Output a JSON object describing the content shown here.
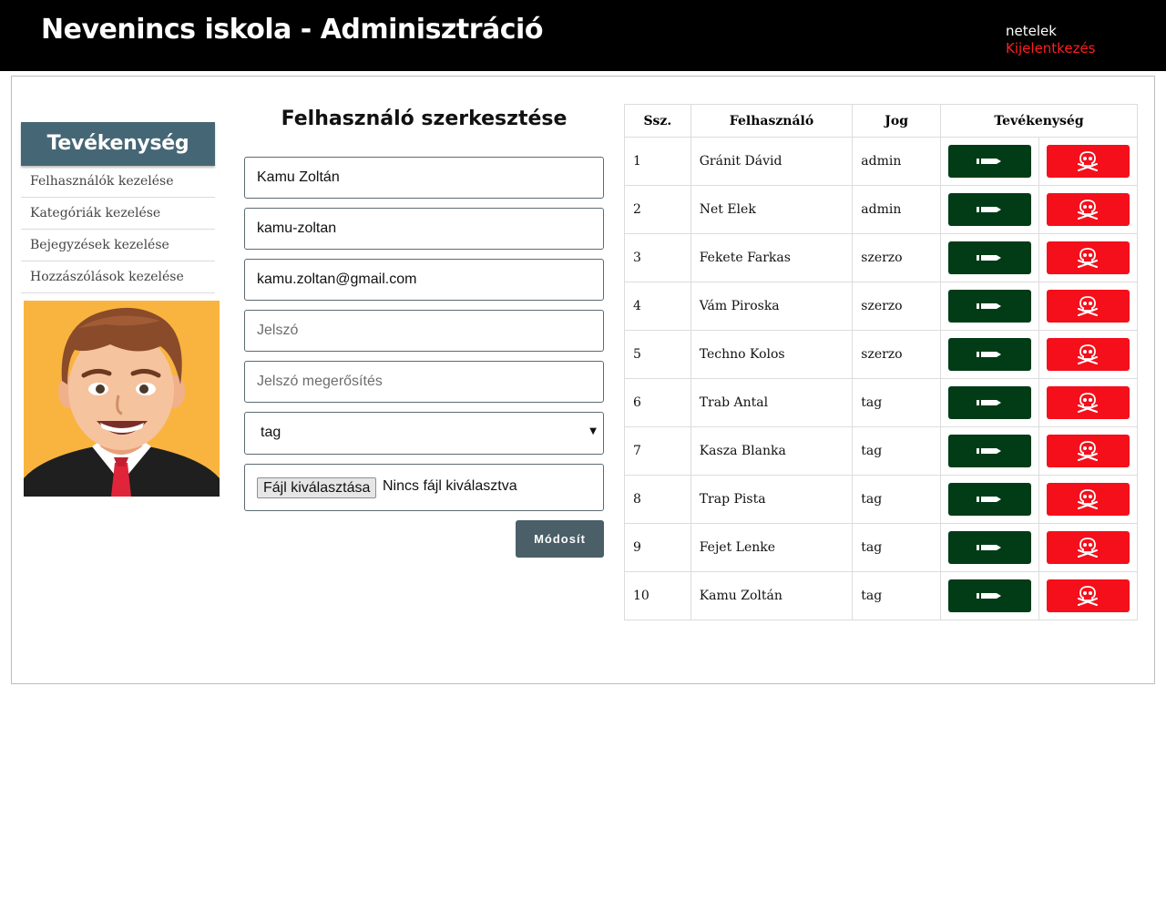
{
  "header": {
    "title": "Nevenincs iskola - Adminisztráció",
    "username": "netelek",
    "logout_label": "Kijelentkezés"
  },
  "sidebar": {
    "heading": "Tevékenység",
    "items": [
      {
        "label": "Felhasználók kezelése"
      },
      {
        "label": "Kategóriák kezelése"
      },
      {
        "label": "Bejegyzések kezelése"
      },
      {
        "label": "Hozzászólások kezelése"
      }
    ]
  },
  "form": {
    "title": "Felhasználó szerkesztése",
    "name_value": "Kamu Zoltán",
    "slug_value": "kamu-zoltan",
    "email_value": "kamu.zoltan@gmail.com",
    "password_placeholder": "Jelszó",
    "password_confirm_placeholder": "Jelszó megerősítés",
    "role_selected": "tag",
    "file_button_label": "Fájl kiválasztása",
    "file_status": "Nincs fájl kiválasztva",
    "submit_label": "Módosít"
  },
  "table": {
    "headers": [
      "Ssz.",
      "Felhasználó",
      "Jog",
      "Tevékenység"
    ],
    "rows": [
      {
        "no": "1",
        "user": "Gránit Dávid",
        "role": "admin"
      },
      {
        "no": "2",
        "user": "Net Elek",
        "role": "admin"
      },
      {
        "no": "3",
        "user": "Fekete Farkas",
        "role": "szerzo"
      },
      {
        "no": "4",
        "user": "Vám Piroska",
        "role": "szerzo"
      },
      {
        "no": "5",
        "user": "Techno Kolos",
        "role": "szerzo"
      },
      {
        "no": "6",
        "user": "Trab Antal",
        "role": "tag"
      },
      {
        "no": "7",
        "user": "Kasza Blanka",
        "role": "tag"
      },
      {
        "no": "8",
        "user": "Trap Pista",
        "role": "tag"
      },
      {
        "no": "9",
        "user": "Fejet Lenke",
        "role": "tag"
      },
      {
        "no": "10",
        "user": "Kamu Zoltán",
        "role": "tag"
      }
    ],
    "edit_icon": "pencil-icon",
    "delete_icon": "skull-crossbones-icon"
  },
  "colors": {
    "header_bg": "#000000",
    "logout": "#ff1e1e",
    "sidebar_head": "#456775",
    "edit_button": "#013c17",
    "delete_button": "#f50f1a",
    "submit_button": "#4a5f68",
    "avatar_bg": "#f9b43f"
  }
}
